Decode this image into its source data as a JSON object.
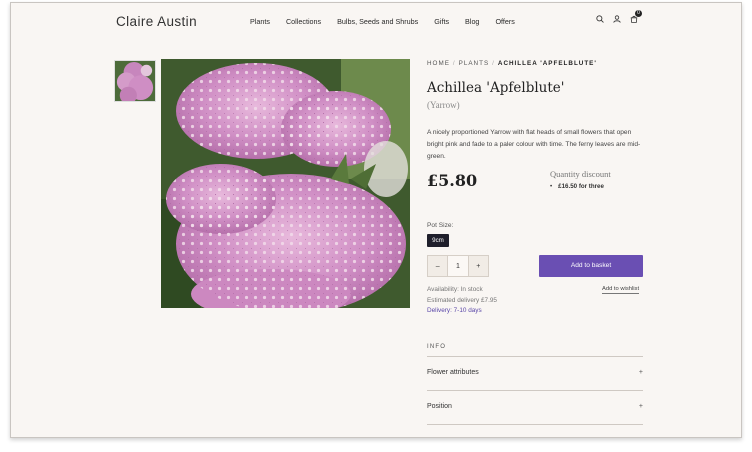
{
  "header": {
    "logo": "Claire Austin",
    "nav": [
      "Plants",
      "Collections",
      "Bulbs, Seeds and Shrubs",
      "Gifts",
      "Blog",
      "Offers"
    ],
    "cart_count": "0",
    "icons": [
      "search-icon",
      "account-icon",
      "cart-icon"
    ]
  },
  "breadcrumb": {
    "home": "HOME",
    "plants": "PLANTS",
    "current": "ACHILLEA 'APFELBLUTE'"
  },
  "product": {
    "title": "Achillea 'Apfelblute'",
    "subtitle": "(Yarrow)",
    "description": "A nicely proportioned Yarrow with flat heads of small flowers that open bright pink and fade to a paler colour with time. The ferny leaves are mid-green.",
    "price": "£5.80",
    "quantity_discount": {
      "title": "Quantity discount",
      "bullet": "•",
      "item": "£16.50 for three"
    },
    "pot_size_label": "Pot Size:",
    "pot_size_option": "9cm",
    "quantity": {
      "minus": "–",
      "value": "1",
      "plus": "+"
    },
    "add_to_basket": "Add to basket",
    "add_to_wishlist": "Add to wishlist",
    "availability": "Availability: In stock",
    "delivery_cost": "Estimated delivery £7.95",
    "delivery_days": "Delivery: 7-10 days"
  },
  "info": {
    "heading": "INFO",
    "sections": [
      {
        "label": "Flower attributes",
        "toggle": "+"
      },
      {
        "label": "Position",
        "toggle": "+"
      }
    ]
  },
  "colors": {
    "background": "#f9f6f3",
    "accent": "#6a4fb3",
    "delivery_text": "#5a47a8",
    "pot_button": "#1f1f2b"
  }
}
